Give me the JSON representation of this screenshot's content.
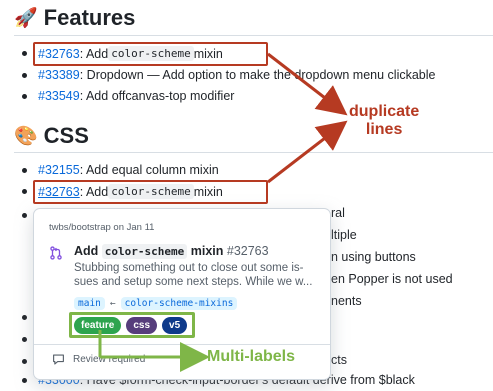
{
  "features": {
    "emoji": "🚀",
    "title": "Features",
    "items": [
      {
        "num": "#32763",
        "pre": ": Add ",
        "code": "color-scheme",
        "post": " mixin"
      },
      {
        "num": "#33389",
        "text": ": Dropdown — Add option to make the dropdown menu clickable"
      },
      {
        "num": "#33549",
        "text": ": Add offcanvas-top modifier"
      }
    ]
  },
  "css": {
    "emoji": "🎨",
    "title": "CSS",
    "items": [
      {
        "num": "#32155",
        "text": ": Add equal column mixin"
      },
      {
        "num": "#32763",
        "pre": ": Add ",
        "code": "color-scheme",
        "post": " mixin"
      }
    ],
    "tails": [
      "ral",
      "ltiple",
      "n using buttons",
      "en Popper is not used",
      "nents",
      "cts"
    ],
    "last_item": {
      "num": "#33000",
      "text": ": Have $form-check-input-border's default derive from $black"
    }
  },
  "popover": {
    "meta": "twbs/bootstrap on Jan 11",
    "title_pre": "Add ",
    "title_code": "color-scheme",
    "title_post": " mixin",
    "number": "#32763",
    "body": "Stubbing something out to close out some is­sues and setup some next steps. While we w...",
    "base_branch": "main",
    "arrow": "←",
    "head_branch": "color-scheme-mixins",
    "labels": [
      {
        "name": "feature",
        "color": "#2da44e"
      },
      {
        "name": "css",
        "color": "#563d7c"
      },
      {
        "name": "v5",
        "color": "#0e3a8a"
      }
    ],
    "review": "Review required"
  },
  "annotations": {
    "duplicate": [
      "duplicate",
      "lines"
    ],
    "multi": "Multi-labels",
    "red_color": "#b63a22",
    "green_color": "#7fb648"
  }
}
